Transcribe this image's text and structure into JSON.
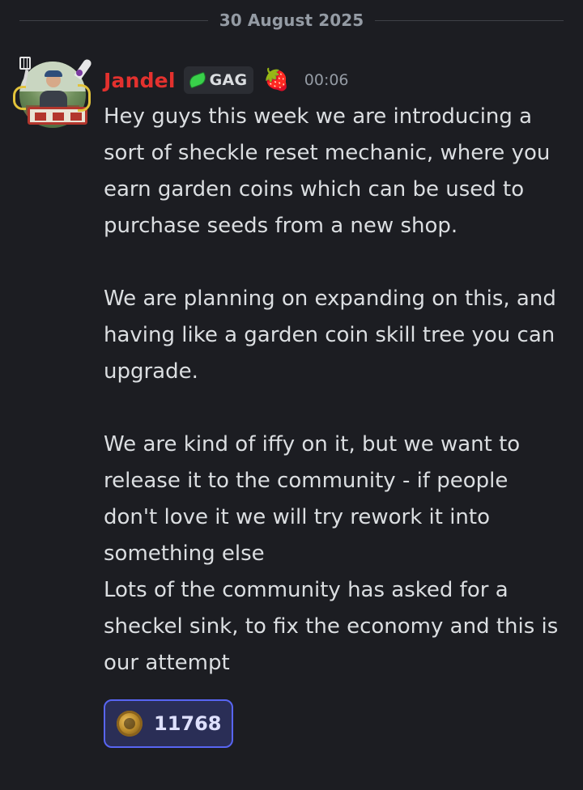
{
  "date_divider": "30 August 2025",
  "message": {
    "author": "Jandel",
    "author_color": "#e3312e",
    "tag": {
      "icon": "leaf-icon",
      "label": "GAG"
    },
    "badge_emoji": "🍓",
    "timestamp": "00:06",
    "paragraphs": [
      "Hey guys this week we are introducing a sort of sheckle reset mechanic, where you earn garden coins which can be used to purchase seeds from a new shop.",
      "",
      "We are planning on expanding on this, and having like a garden coin skill tree you can upgrade.",
      "",
      "We are kind of iffy on it, but we want to release it to the community - if people don't love it we will try rework it into something else",
      "Lots of the community has asked for a sheckel sink, to fix the economy and this is our attempt"
    ],
    "reaction": {
      "icon": "coin-icon",
      "count": "11768"
    }
  }
}
